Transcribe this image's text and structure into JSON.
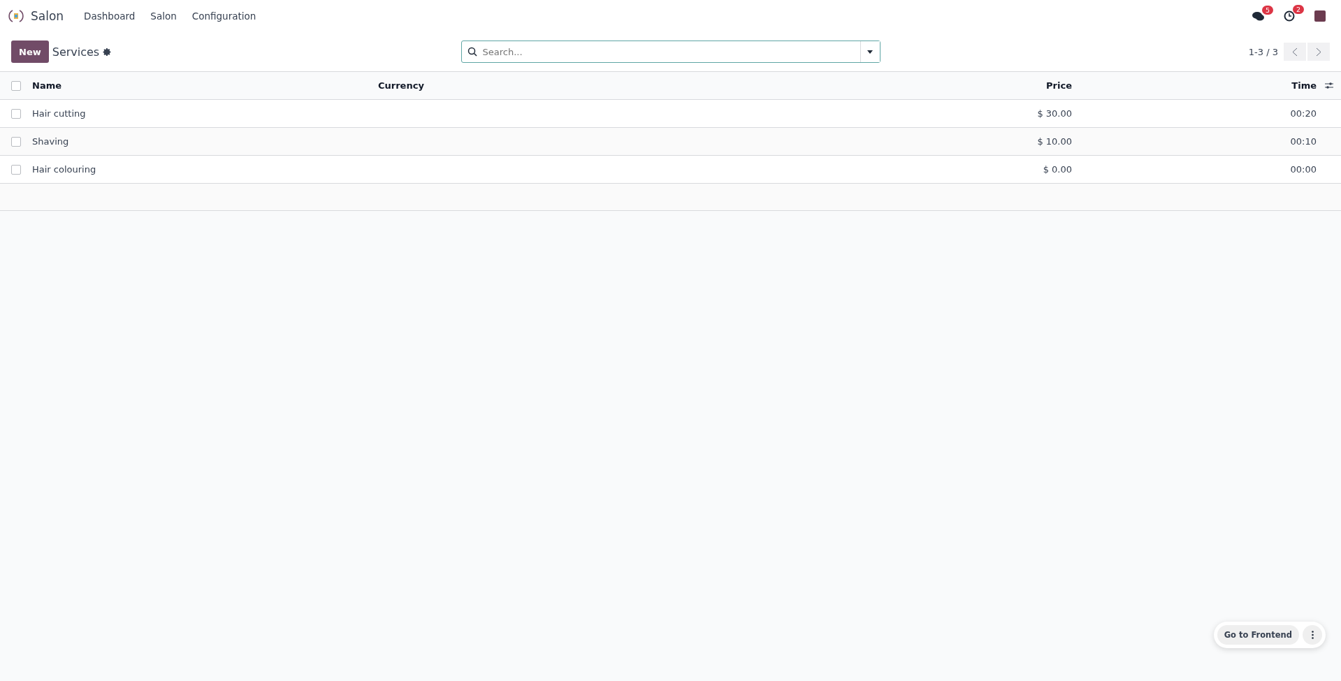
{
  "navbar": {
    "app_name": "Salon",
    "menu": [
      "Dashboard",
      "Salon",
      "Configuration"
    ],
    "messages_badge": "5",
    "activities_badge": "2"
  },
  "control_panel": {
    "new_button": "New",
    "breadcrumb": "Services",
    "search": {
      "placeholder": "Search..."
    },
    "pager": "1-3 / 3"
  },
  "table": {
    "columns": [
      {
        "label": "Name"
      },
      {
        "label": "Currency"
      },
      {
        "label": "Price"
      },
      {
        "label": "Time"
      }
    ],
    "all_selected": false,
    "rows": [
      {
        "name": "Hair cutting",
        "price": "$ 30.00",
        "time": "00:20",
        "selected": false
      },
      {
        "name": "Shaving",
        "price": "$ 10.00",
        "time": "00:10",
        "selected": false
      },
      {
        "name": "Hair colouring",
        "price": "$ 0.00",
        "time": "00:00",
        "selected": false
      }
    ]
  },
  "frontend_bar": {
    "button": "Go to Frontend"
  }
}
